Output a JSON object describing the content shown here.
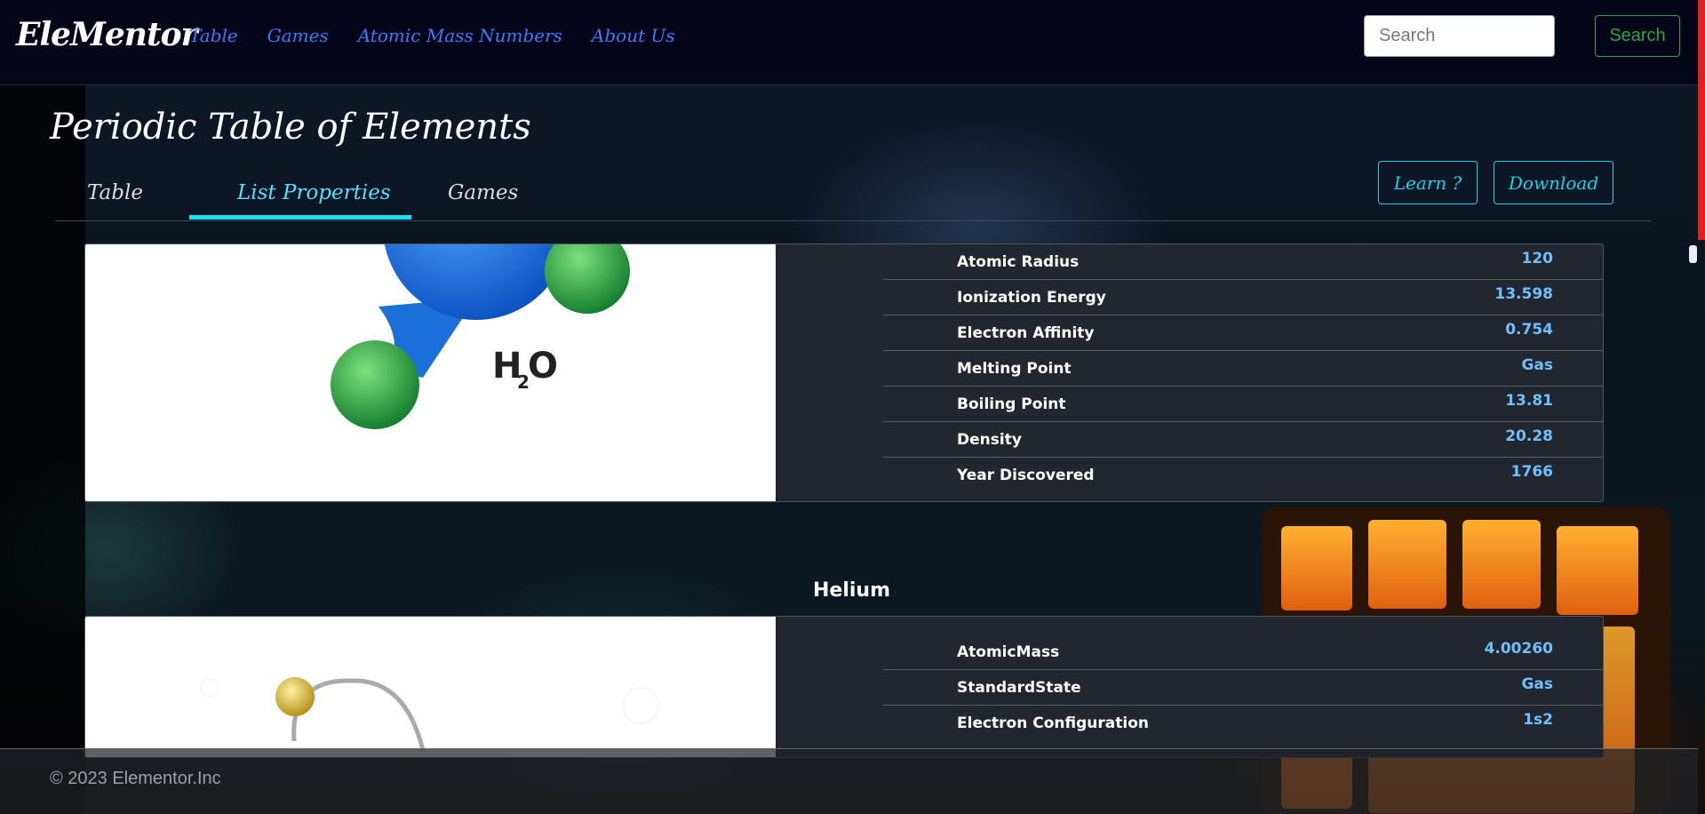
{
  "navbar": {
    "brand": "EleMentor",
    "links": [
      "Table",
      "Games",
      "Atomic Mass Numbers",
      "About Us"
    ],
    "search_placeholder": "Search",
    "search_button": "Search"
  },
  "page": {
    "title": "Periodic Table of Elements",
    "tabs": [
      "Table",
      "List Properties",
      "Games"
    ],
    "active_tab": "List Properties",
    "learn_button": "Learn ?",
    "download_button": "Download"
  },
  "elements": [
    {
      "name": "",
      "image_label": "H",
      "image_sub": "2",
      "image_suffix": "O",
      "properties": [
        {
          "name": "Atomic Radius",
          "value": "120"
        },
        {
          "name": "Ionization Energy",
          "value": "13.598"
        },
        {
          "name": "Electron Affinity",
          "value": "0.754"
        },
        {
          "name": "Melting Point",
          "value": "Gas"
        },
        {
          "name": "Boiling Point",
          "value": "13.81"
        },
        {
          "name": "Density",
          "value": "20.28"
        },
        {
          "name": "Year Discovered",
          "value": "1766"
        }
      ]
    },
    {
      "name": "Helium",
      "properties": [
        {
          "name": "AtomicMass",
          "value": "4.00260"
        },
        {
          "name": "StandardState",
          "value": "Gas"
        },
        {
          "name": "Electron Configuration",
          "value": "1s2"
        }
      ]
    }
  ],
  "footer": {
    "copyright": "© 2023 Elementor.Inc"
  },
  "colors": {
    "navbar_bg": "#05051a",
    "nav_link": "#3a7bff",
    "accent_cyan": "#19e3f2",
    "search_green": "#28a745",
    "card_bg": "#22262e",
    "value_blue": "#6fbfff"
  }
}
